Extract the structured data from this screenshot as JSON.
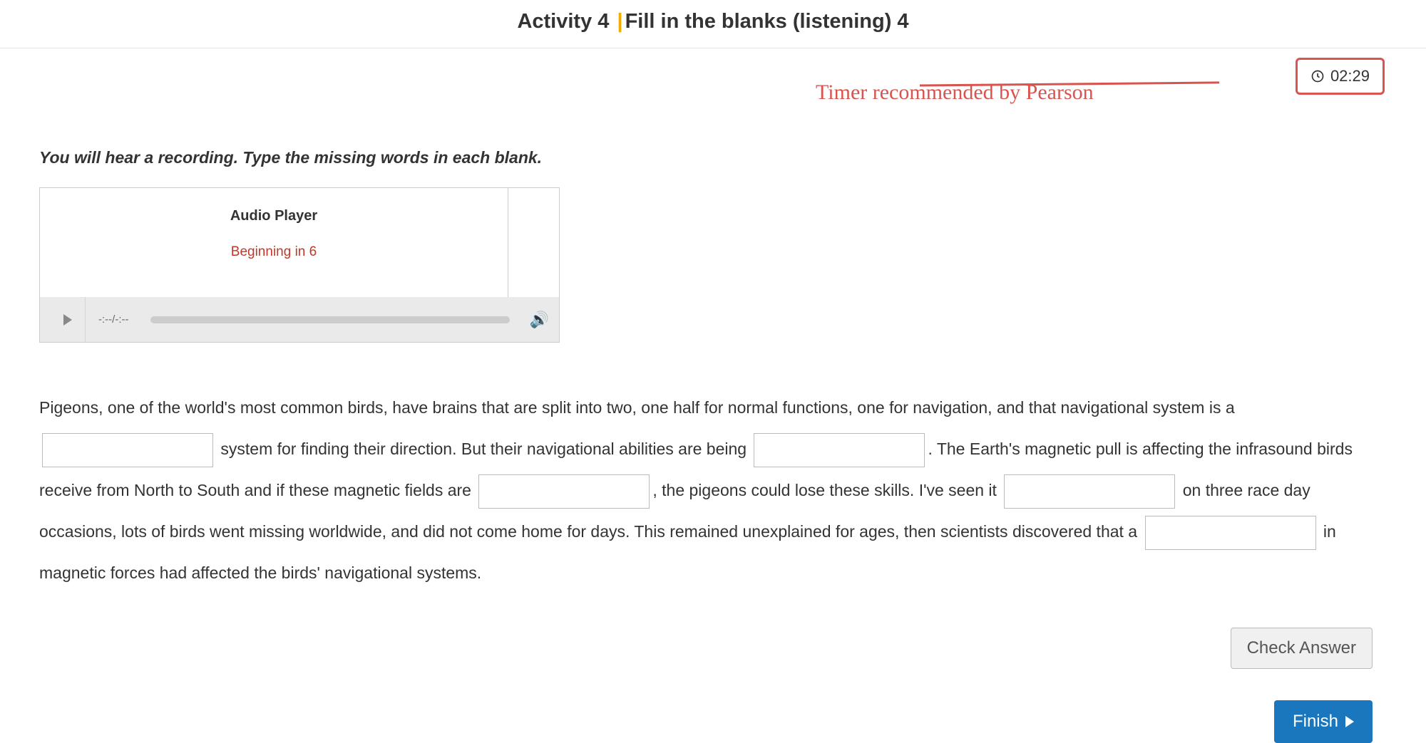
{
  "header": {
    "activity_prefix": "Activity 4 ",
    "activity_title": "Fill in the blanks (listening) 4"
  },
  "timer": {
    "value": "02:29"
  },
  "annotation": {
    "text": "Timer recommended by Pearson"
  },
  "instructions": "You will hear a recording. Type the missing words in each blank.",
  "audio": {
    "label": "Audio Player",
    "status": "Beginning in 6",
    "time_display": "-:--/-:--"
  },
  "passage": {
    "seg1": "Pigeons, one of the world's most common birds, have brains that are split into two, one half for normal functions, one for navigation, and that navigational system is a ",
    "seg2": " system for finding their direction. But their navigational abilities are being ",
    "seg3": ". The Earth's magnetic pull is affecting the infrasound birds receive from North to South and if these magnetic fields are ",
    "seg4": ", the pigeons could lose these skills. I've seen it ",
    "seg5": " on three race day occasions, lots of birds went missing worldwide, and did not come home for days. This remained unexplained for ages, then scientists discovered that a ",
    "seg6": " in magnetic forces had affected the birds' navigational systems."
  },
  "buttons": {
    "check": "Check Answer",
    "finish": "Finish"
  }
}
